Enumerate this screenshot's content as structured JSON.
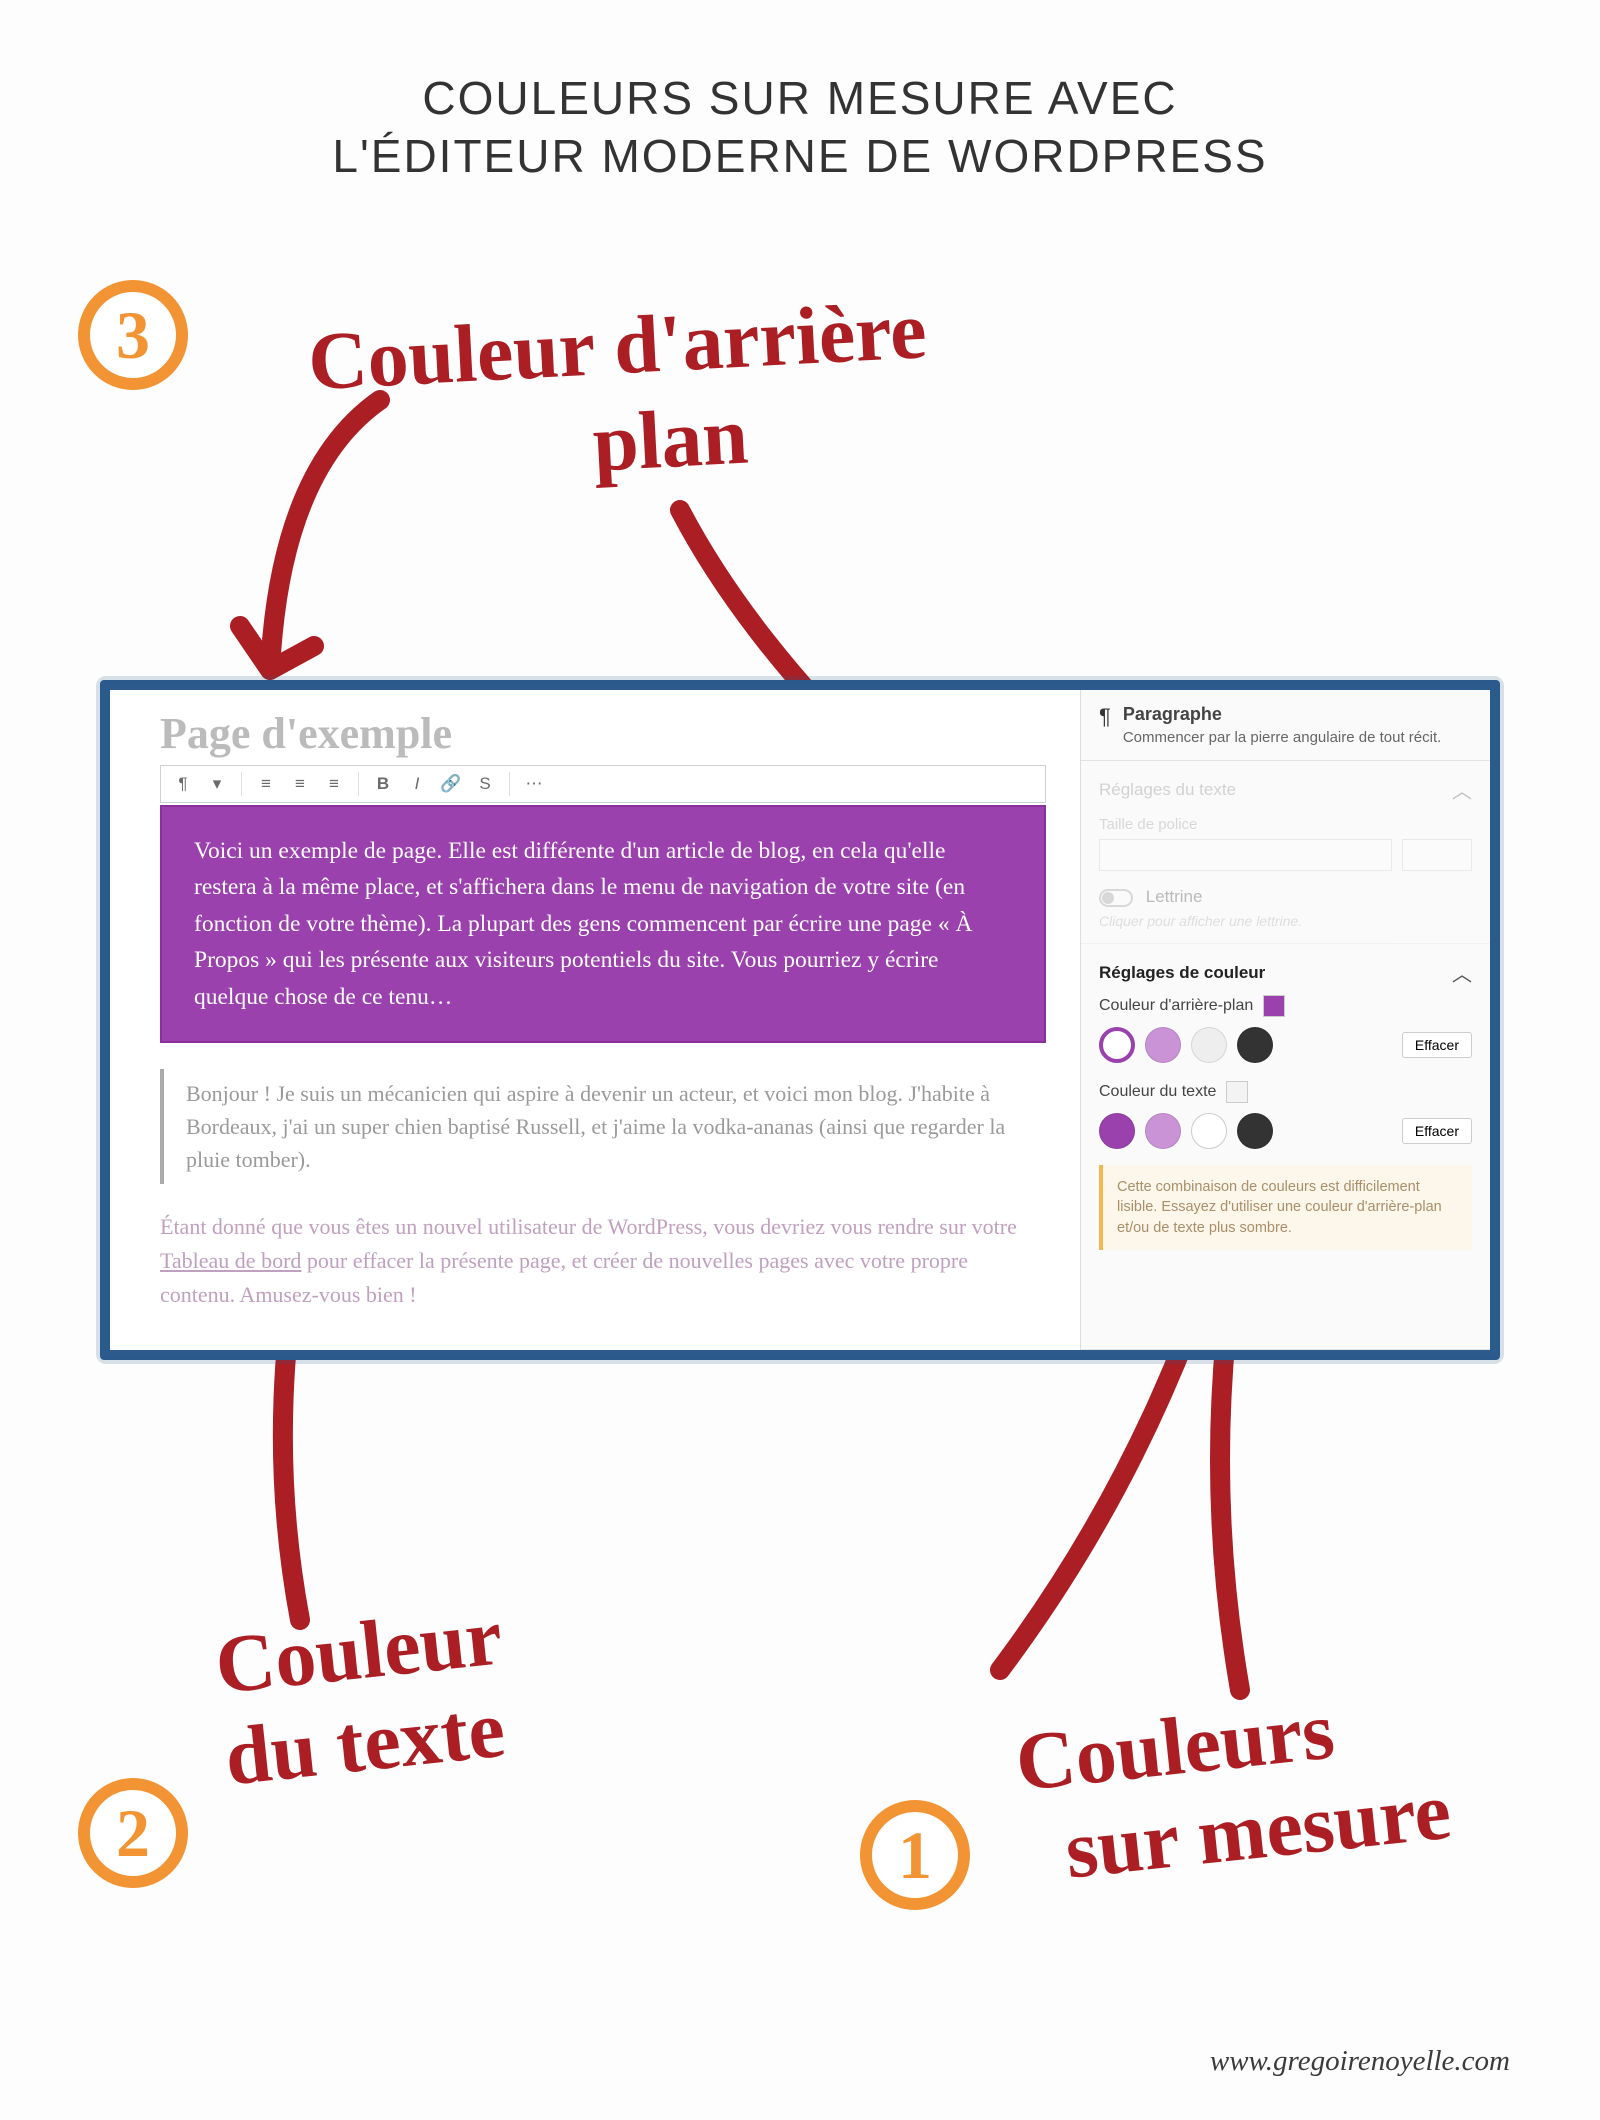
{
  "title_line1": "COULEURS SUR MESURE AVEC",
  "title_line2": "L'ÉDITEUR MODERNE DE WORDPRESS",
  "attribution": "www.gregoirenoyelle.com",
  "steps": {
    "s1": "1",
    "s2": "2",
    "s3": "3"
  },
  "annotations": {
    "bg_line1": "Couleur d'arrière",
    "bg_line2": "plan",
    "text_line1": "Couleur",
    "text_line2": "du texte",
    "custom_line1": "Couleurs",
    "custom_line2": "sur mesure"
  },
  "editor": {
    "page_title": "Page d'exemple",
    "block_text": "Voici un exemple de page. Elle est différente d'un article de blog, en cela qu'elle restera à la même place, et s'affichera dans le menu de navigation de votre site (en fonction de votre thème). La plupart des gens commencent par écrire une page « À Propos » qui les présente aux visiteurs potentiels du site. Vous pourriez y écrire quelque chose de ce tenu…",
    "blockquote": "Bonjour ! Je suis un mécanicien qui aspire à devenir un acteur, et voici mon blog. J'habite à Bordeaux, j'ai un super chien baptisé Russell, et j'aime la vodka-ananas (ainsi que regarder la pluie tomber).",
    "p2_a": "Étant donné que vous êtes un nouvel utilisateur de WordPress, vous devriez vous rendre sur votre ",
    "p2_link": "Tableau de bord",
    "p2_b": " pour effacer la présente page, et créer de nouvelles pages avec votre propre contenu. Amusez-vous bien !"
  },
  "sidebar": {
    "block_type": "Paragraphe",
    "block_desc": "Commencer par la pierre angulaire de tout récit.",
    "text_settings": "Réglages du texte",
    "font_size": "Taille de police",
    "dropcap": "Lettrine",
    "dropcap_hint": "Cliquer pour afficher une lettrine.",
    "color_settings": "Réglages de couleur",
    "bg_label": "Couleur d'arrière-plan",
    "text_label": "Couleur du texte",
    "clear": "Effacer",
    "warning": "Cette combinaison de couleurs est difficilement lisible. Essayez d'utiliser une couleur d'arrière-plan et/ou de texte plus sombre."
  },
  "colors": {
    "bg_selected": "#9a41ad",
    "text_selected": "#f3f3f3",
    "palette": [
      "#9a41ad",
      "#c993d6",
      "#eeeeee",
      "#333333"
    ]
  }
}
